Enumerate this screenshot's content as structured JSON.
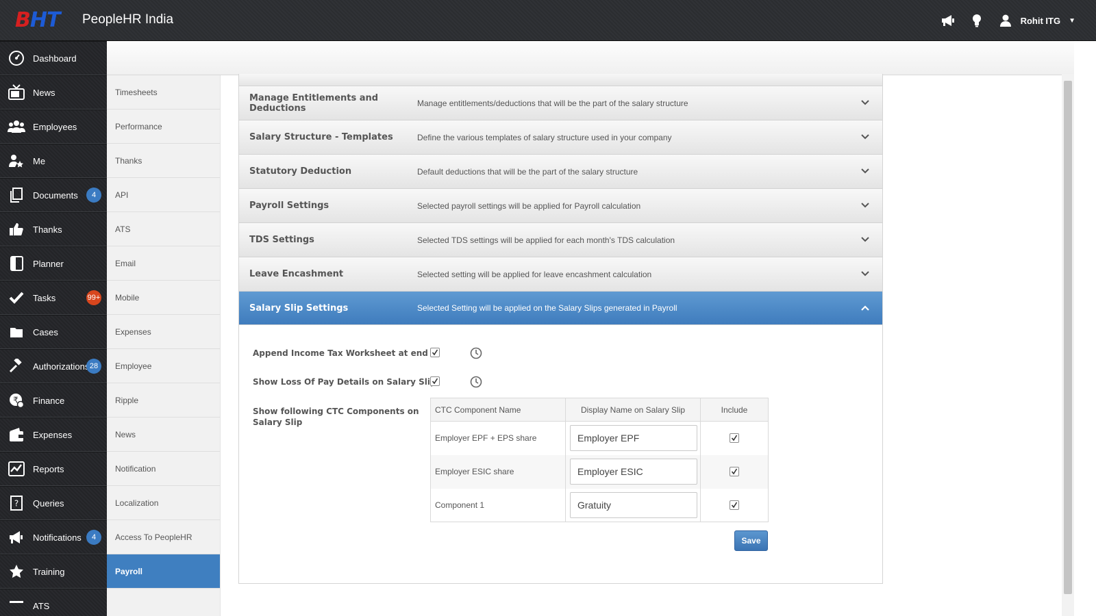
{
  "app": {
    "logo_text": "BHT",
    "brand": "PeopleHR India",
    "user_name": "Rohit ITG"
  },
  "topbar_icons": [
    "megaphone-icon",
    "lightbulb-icon",
    "user-icon",
    "chevron-down-icon"
  ],
  "leftnav": [
    {
      "label": "Dashboard",
      "icon": "dashboard-icon"
    },
    {
      "label": "News",
      "icon": "tv-icon"
    },
    {
      "label": "Employees",
      "icon": "users-icon"
    },
    {
      "label": "Me",
      "icon": "user-star-icon"
    },
    {
      "label": "Documents",
      "icon": "documents-icon",
      "badge": "4"
    },
    {
      "label": "Thanks",
      "icon": "thumbs-up-icon"
    },
    {
      "label": "Planner",
      "icon": "planner-icon"
    },
    {
      "label": "Tasks",
      "icon": "check-icon",
      "badge": "99+"
    },
    {
      "label": "Cases",
      "icon": "folder-icon"
    },
    {
      "label": "Authorizations",
      "icon": "gavel-icon",
      "badge": "28"
    },
    {
      "label": "Finance",
      "icon": "rupee-icon"
    },
    {
      "label": "Expenses",
      "icon": "wallet-icon"
    },
    {
      "label": "Reports",
      "icon": "chart-icon"
    },
    {
      "label": "Queries",
      "icon": "question-icon"
    },
    {
      "label": "Notifications",
      "icon": "megaphone-icon",
      "badge": "4"
    },
    {
      "label": "Training",
      "icon": "star-icon"
    },
    {
      "label": "ATS",
      "icon": "list-icon"
    }
  ],
  "subnav": [
    {
      "label": "Timesheets"
    },
    {
      "label": "Performance"
    },
    {
      "label": "Thanks"
    },
    {
      "label": "API"
    },
    {
      "label": "ATS"
    },
    {
      "label": "Email"
    },
    {
      "label": "Mobile"
    },
    {
      "label": "Expenses"
    },
    {
      "label": "Employee"
    },
    {
      "label": "Ripple"
    },
    {
      "label": "News"
    },
    {
      "label": "Notification"
    },
    {
      "label": "Localization"
    },
    {
      "label": "Access To PeopleHR"
    },
    {
      "label": "Payroll",
      "active": true
    }
  ],
  "accordion": [
    {
      "title": "Manage Entitlements and Deductions",
      "desc": "Manage entitlements/deductions that will be the part of the salary structure"
    },
    {
      "title": "Salary Structure - Templates",
      "desc": "Define the various templates of salary structure used in your company"
    },
    {
      "title": "Statutory Deduction",
      "desc": "Default deductions that will be the part of the salary structure"
    },
    {
      "title": "Payroll Settings",
      "desc": "Selected payroll settings will be applied for Payroll calculation"
    },
    {
      "title": "TDS Settings",
      "desc": "Selected TDS settings will be applied for each month's TDS calculation"
    },
    {
      "title": "Leave Encashment",
      "desc": "Selected setting will be applied for leave encashment calculation"
    }
  ],
  "active_section": {
    "title": "Salary Slip Settings",
    "desc": "Selected Setting will be applied on the Salary Slips generated in Payroll"
  },
  "settings": {
    "append_tax_label": "Append Income Tax Worksheet at end",
    "append_tax_checked": true,
    "loss_of_pay_label": "Show Loss Of Pay Details on Salary Slip",
    "loss_of_pay_checked": true,
    "ctc_label_line1": "Show following CTC Components on",
    "ctc_label_line2": "Salary Slip"
  },
  "ctc_table": {
    "headers": [
      "CTC Component Name",
      "Display Name on Salary Slip",
      "Include"
    ],
    "rows": [
      {
        "component": "Employer EPF + EPS share",
        "display_name": "Employer EPF",
        "include": true
      },
      {
        "component": "Employer ESIC share",
        "display_name": "Employer ESIC",
        "include": true
      },
      {
        "component": "Component 1",
        "display_name": "Gratuity",
        "include": true
      }
    ]
  },
  "save_label": "Save",
  "colors": {
    "accent": "#3f7fc0",
    "badge_blue": "#3b7bc2",
    "badge_red": "#d8461d"
  }
}
